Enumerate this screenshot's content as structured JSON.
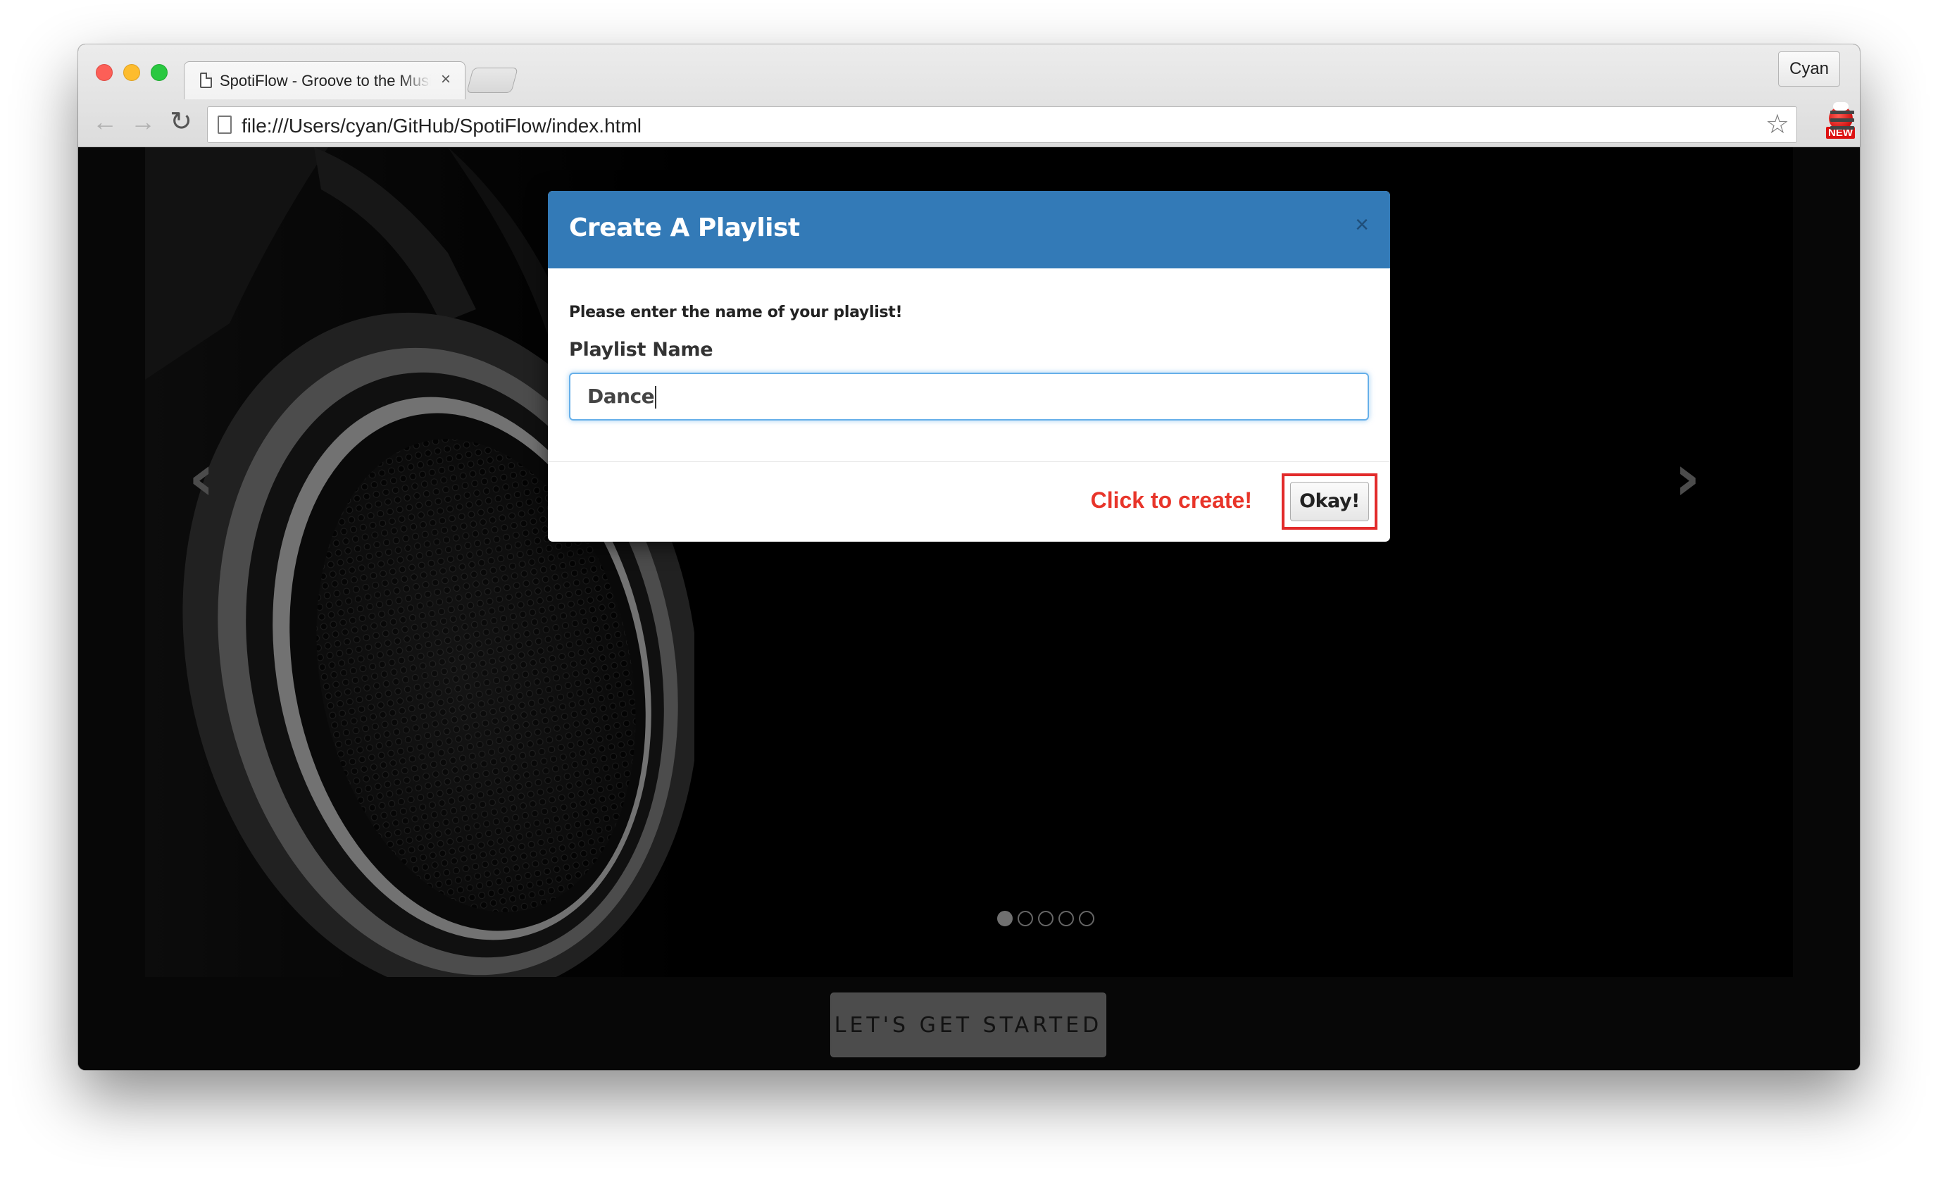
{
  "browser": {
    "tab_title": "SpotiFlow - Groove to the Music",
    "tab_close": "×",
    "profile_name": "Cyan",
    "url": "file:///Users/cyan/GitHub/SpotiFlow/index.html",
    "extension_badge": "NEW"
  },
  "modal": {
    "title": "Create A Playlist",
    "close": "×",
    "prompt": "Please enter the name of your playlist!",
    "field_label": "Playlist Name",
    "field_value": "Dance",
    "annotation": "Click to create!",
    "okay_label": "Okay!"
  },
  "carousel": {
    "slide_count": 5,
    "active_index": 0,
    "prev_arrow": "‹",
    "next_arrow": "›"
  },
  "page": {
    "start_button": "LET'S GET STARTED"
  },
  "colors": {
    "modal_header": "#337ab7",
    "annotation": "#e8352a",
    "highlight_border": "#e22b2b"
  }
}
